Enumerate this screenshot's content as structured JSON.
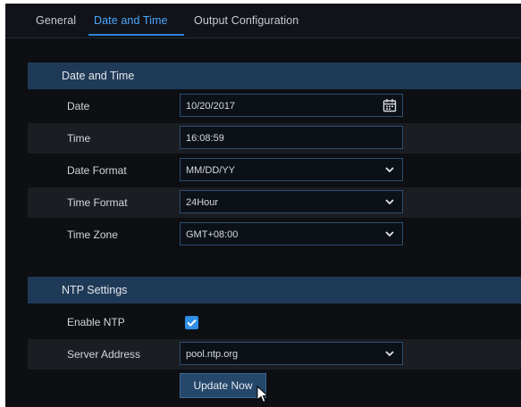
{
  "tabs": [
    {
      "label": "General"
    },
    {
      "label": "Date and Time"
    },
    {
      "label": "Output Configuration"
    }
  ],
  "date_time_section": {
    "title": "Date and Time",
    "date": {
      "label": "Date",
      "value": "10/20/2017",
      "icon": "calendar-icon"
    },
    "time": {
      "label": "Time",
      "value": "16:08:59"
    },
    "date_format": {
      "label": "Date Format",
      "value": "MM/DD/YY"
    },
    "time_format": {
      "label": "Time Format",
      "value": "24Hour"
    },
    "time_zone": {
      "label": "Time Zone",
      "value": "GMT+08:00"
    }
  },
  "ntp_section": {
    "title": "NTP Settings",
    "enable_ntp": {
      "label": "Enable NTP",
      "checked": true
    },
    "server_address": {
      "label": "Server Address",
      "value": "pool.ntp.org"
    },
    "update_button": "Update Now"
  },
  "colors": {
    "accent": "#2f8ee6",
    "header_bg": "#1f3a57",
    "background": "#0d0f13"
  }
}
